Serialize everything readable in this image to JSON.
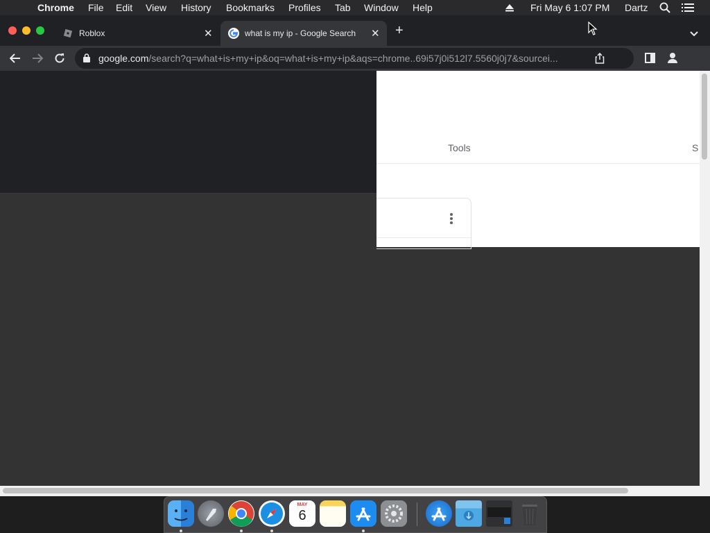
{
  "menubar": {
    "app_name": "Chrome",
    "menus": [
      "File",
      "Edit",
      "View",
      "History",
      "Bookmarks",
      "Profiles",
      "Tab",
      "Window",
      "Help"
    ],
    "datetime": "Fri May 6  1:07 PM",
    "user": "Dartz"
  },
  "tabs": [
    {
      "title": "Roblox",
      "active": false
    },
    {
      "title": "what is my ip - Google Search",
      "active": true
    }
  ],
  "toolbar": {
    "url_host": "google.com",
    "url_path": "/search?q=what+is+my+ip&oq=what+is+my+ip&aqs=chrome..69i57j0i512l7.5560j0j7&sourcei..."
  },
  "page": {
    "tools_label": "Tools",
    "settings_fragment": "S"
  },
  "dock": {
    "calendar_month": "MAY",
    "calendar_day": "6"
  },
  "colors": {
    "menubar_bg": "#2a2a2c",
    "tabstrip_bg": "#202124",
    "active_tab_bg": "#35363a",
    "content_bg": "#333333",
    "traffic_red": "#ff5f57",
    "traffic_yellow": "#febc2e",
    "traffic_green": "#28c840"
  }
}
